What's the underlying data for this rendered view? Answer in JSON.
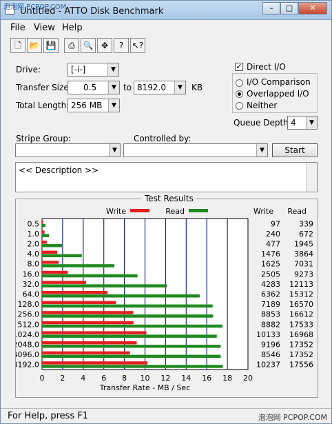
{
  "window": {
    "title": "Untitled - ATTO Disk Benchmark",
    "watermark_top": "泡泡网 PCPOP.COM"
  },
  "menu": {
    "file": "File",
    "view": "View",
    "help": "Help"
  },
  "toolbar": [
    "new-icon",
    "open-icon",
    "save-icon",
    "print-icon",
    "print-preview-icon",
    "move-icon",
    "help-icon",
    "context-help-icon"
  ],
  "settings": {
    "drive_label": "Drive:",
    "drive_value": "[-i-]",
    "transfer_size_label": "Transfer Size:",
    "transfer_from": "0.5",
    "to_label": "to",
    "transfer_to": "8192.0",
    "kb_label": "KB",
    "total_length_label": "Total Length:",
    "total_length_value": "256 MB"
  },
  "options": {
    "direct_io_label": "Direct I/O",
    "direct_io_checked": true,
    "io_comparison_label": "I/O Comparison",
    "overlapped_io_label": "Overlapped I/O",
    "neither_label": "Neither",
    "selected": "overlapped",
    "queue_depth_label": "Queue Depth:",
    "queue_depth_value": "4"
  },
  "stripe": {
    "stripe_group_label": "Stripe Group:",
    "controlled_by_label": "Controlled by:",
    "start_label": "Start"
  },
  "description": "<< Description >>",
  "chart_data": {
    "type": "bar",
    "title": "Test Results",
    "xlabel": "Transfer Rate - MB / Sec",
    "xlim": [
      0,
      20
    ],
    "xticks": [
      "0",
      "2",
      "4",
      "6",
      "8",
      "10",
      "12",
      "14",
      "16",
      "18",
      "20"
    ],
    "categories": [
      "0.5",
      "1.0",
      "2.0",
      "4.0",
      "8.0",
      "16.0",
      "32.0",
      "64.0",
      "128.0",
      "256.0",
      "512.0",
      "1024.0",
      "2048.0",
      "4096.0",
      "8192.0"
    ],
    "write_col_label": "Write",
    "read_col_label": "Read",
    "series": [
      {
        "name": "Write",
        "color": "#e02020",
        "values": [
          97,
          240,
          477,
          1476,
          1625,
          2505,
          4283,
          6362,
          7189,
          8853,
          8882,
          10133,
          9196,
          8546,
          10237
        ]
      },
      {
        "name": "Read",
        "color": "#1f8a1f",
        "values": [
          339,
          672,
          1945,
          3864,
          7031,
          9273,
          12113,
          15312,
          16570,
          16612,
          17533,
          16968,
          17352,
          17352,
          17556
        ]
      }
    ]
  },
  "status": {
    "text": "For Help, press F1",
    "watermark": "泡泡网 PCPOP.COM"
  }
}
